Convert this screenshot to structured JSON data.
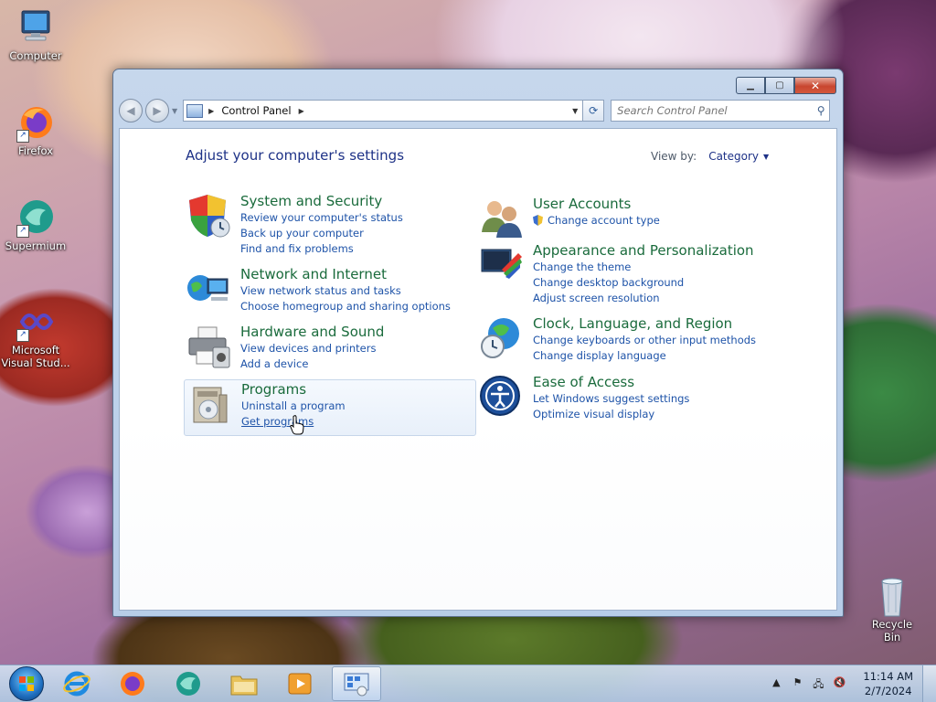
{
  "desktop": {
    "icons": [
      {
        "label": "Computer"
      },
      {
        "label": "Firefox"
      },
      {
        "label": "Supermium"
      },
      {
        "label": "Microsoft Visual Stud..."
      }
    ],
    "recycle_bin": "Recycle Bin"
  },
  "window": {
    "address": {
      "path": [
        "Control Panel"
      ]
    },
    "search": {
      "placeholder": "Search Control Panel"
    },
    "page_title": "Adjust your computer's settings",
    "view_by": {
      "label": "View by:",
      "value": "Category"
    },
    "categories_left": [
      {
        "title": "System and Security",
        "icon": "shield-icon",
        "links": [
          "Review your computer's status",
          "Back up your computer",
          "Find and fix problems"
        ]
      },
      {
        "title": "Network and Internet",
        "icon": "network-icon",
        "links": [
          "View network status and tasks",
          "Choose homegroup and sharing options"
        ]
      },
      {
        "title": "Hardware and Sound",
        "icon": "printer-icon",
        "links": [
          "View devices and printers",
          "Add a device"
        ]
      },
      {
        "title": "Programs",
        "icon": "programs-icon",
        "links": [
          "Uninstall a program",
          "Get programs"
        ]
      }
    ],
    "categories_right": [
      {
        "title": "User Accounts",
        "icon": "users-icon",
        "links": [
          "Change account type"
        ]
      },
      {
        "title": "Appearance and Personalization",
        "icon": "appearance-icon",
        "links": [
          "Change the theme",
          "Change desktop background",
          "Adjust screen resolution"
        ]
      },
      {
        "title": "Clock, Language, and Region",
        "icon": "globe-clock-icon",
        "links": [
          "Change keyboards or other input methods",
          "Change display language"
        ]
      },
      {
        "title": "Ease of Access",
        "icon": "ease-of-access-icon",
        "links": [
          "Let Windows suggest settings",
          "Optimize visual display"
        ]
      }
    ]
  },
  "taskbar": {
    "clock": {
      "time": "11:14 AM",
      "date": "2/7/2024"
    }
  },
  "colors": {
    "category_title": "#1a6b3c",
    "link": "#1e53a8",
    "heading": "#1e3287"
  }
}
